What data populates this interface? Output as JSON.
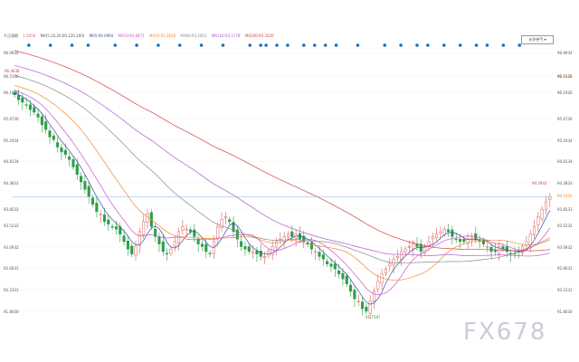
{
  "legend": {
    "title": "千正周期",
    "close": "1.0456",
    "ma_set": "MA(5,10,20,60,120,200)",
    "ma5": "MA5:94.0994",
    "ma10": "MA10:93.8871",
    "ma20": "MA20:93.2618",
    "ma60": "MA60:93.2813",
    "ma120": "MA120:93.1778",
    "ma200": "MA200:93.3320"
  },
  "selector": {
    "label": "允许充气 ▾"
  },
  "markers": {
    "high": "96.4638",
    "low": "91.7387",
    "recent_high": "94.2943",
    "current": "94.1020",
    "right_ma": "96.0717"
  },
  "watermark": "FX678",
  "colors": {
    "up": "#e35b5b",
    "down": "#2e9e48",
    "ma5": "#3a4fa8",
    "ma10": "#d44fd4",
    "ma20": "#ef8a33",
    "ma60": "#8a8a8a",
    "ma120": "#b05ad0",
    "ma200": "#d44040",
    "event": "#1f6fb5"
  },
  "chart_data": {
    "type": "candlestick",
    "y_ticks": [
      "96.9934",
      "96.5336",
      "96.1926",
      "95.6730",
      "95.2434",
      "94.8134",
      "94.3833",
      "93.8533",
      "93.5232",
      "93.0932",
      "92.6631",
      "92.2331",
      "91.8030"
    ],
    "ylim": [
      91.58,
      97.2
    ],
    "close": [
      96.15,
      96.05,
      96.0,
      95.95,
      95.85,
      95.8,
      95.7,
      95.55,
      95.45,
      95.3,
      95.25,
      95.1,
      95.0,
      94.95,
      94.85,
      94.7,
      94.55,
      94.4,
      94.25,
      94.1,
      93.95,
      93.8,
      93.75,
      93.6,
      93.55,
      93.5,
      93.45,
      93.35,
      93.2,
      93.05,
      92.95,
      93.1,
      93.4,
      93.6,
      93.75,
      93.5,
      93.3,
      93.15,
      93.0,
      92.95,
      93.05,
      93.2,
      93.4,
      93.5,
      93.45,
      93.4,
      93.3,
      93.15,
      93.1,
      93.0,
      92.95,
      93.2,
      93.5,
      93.65,
      93.7,
      93.6,
      93.4,
      93.25,
      93.1,
      93.05,
      93.0,
      93.0,
      92.95,
      92.9,
      92.9,
      93.0,
      93.1,
      93.2,
      93.25,
      93.3,
      93.35,
      93.3,
      93.35,
      93.25,
      93.2,
      93.15,
      93.05,
      93.0,
      92.9,
      92.85,
      92.75,
      92.7,
      92.65,
      92.55,
      92.45,
      92.35,
      92.2,
      92.05,
      92.0,
      91.85,
      91.8,
      92.0,
      92.2,
      92.4,
      92.55,
      92.65,
      92.75,
      92.85,
      92.9,
      93.0,
      93.05,
      93.1,
      93.15,
      93.1,
      93.0,
      93.1,
      93.2,
      93.3,
      93.35,
      93.4,
      93.45,
      93.4,
      93.3,
      93.25,
      93.2,
      93.2,
      93.25,
      93.3,
      93.25,
      93.2,
      93.15,
      93.1,
      93.0,
      93.0,
      93.1,
      93.05,
      93.0,
      92.95,
      92.95,
      93.0,
      93.1,
      93.2,
      93.35,
      93.5,
      93.7,
      93.85,
      94.0,
      94.1
    ]
  },
  "events": [
    0.03,
    0.07,
    0.11,
    0.14,
    0.19,
    0.23,
    0.27,
    0.31,
    0.35,
    0.39,
    0.44,
    0.46,
    0.47,
    0.49,
    0.51,
    0.54,
    0.56,
    0.58,
    0.6,
    0.64,
    0.69,
    0.72,
    0.75,
    0.77,
    0.8,
    0.83,
    0.86,
    0.88,
    0.91,
    0.94
  ]
}
